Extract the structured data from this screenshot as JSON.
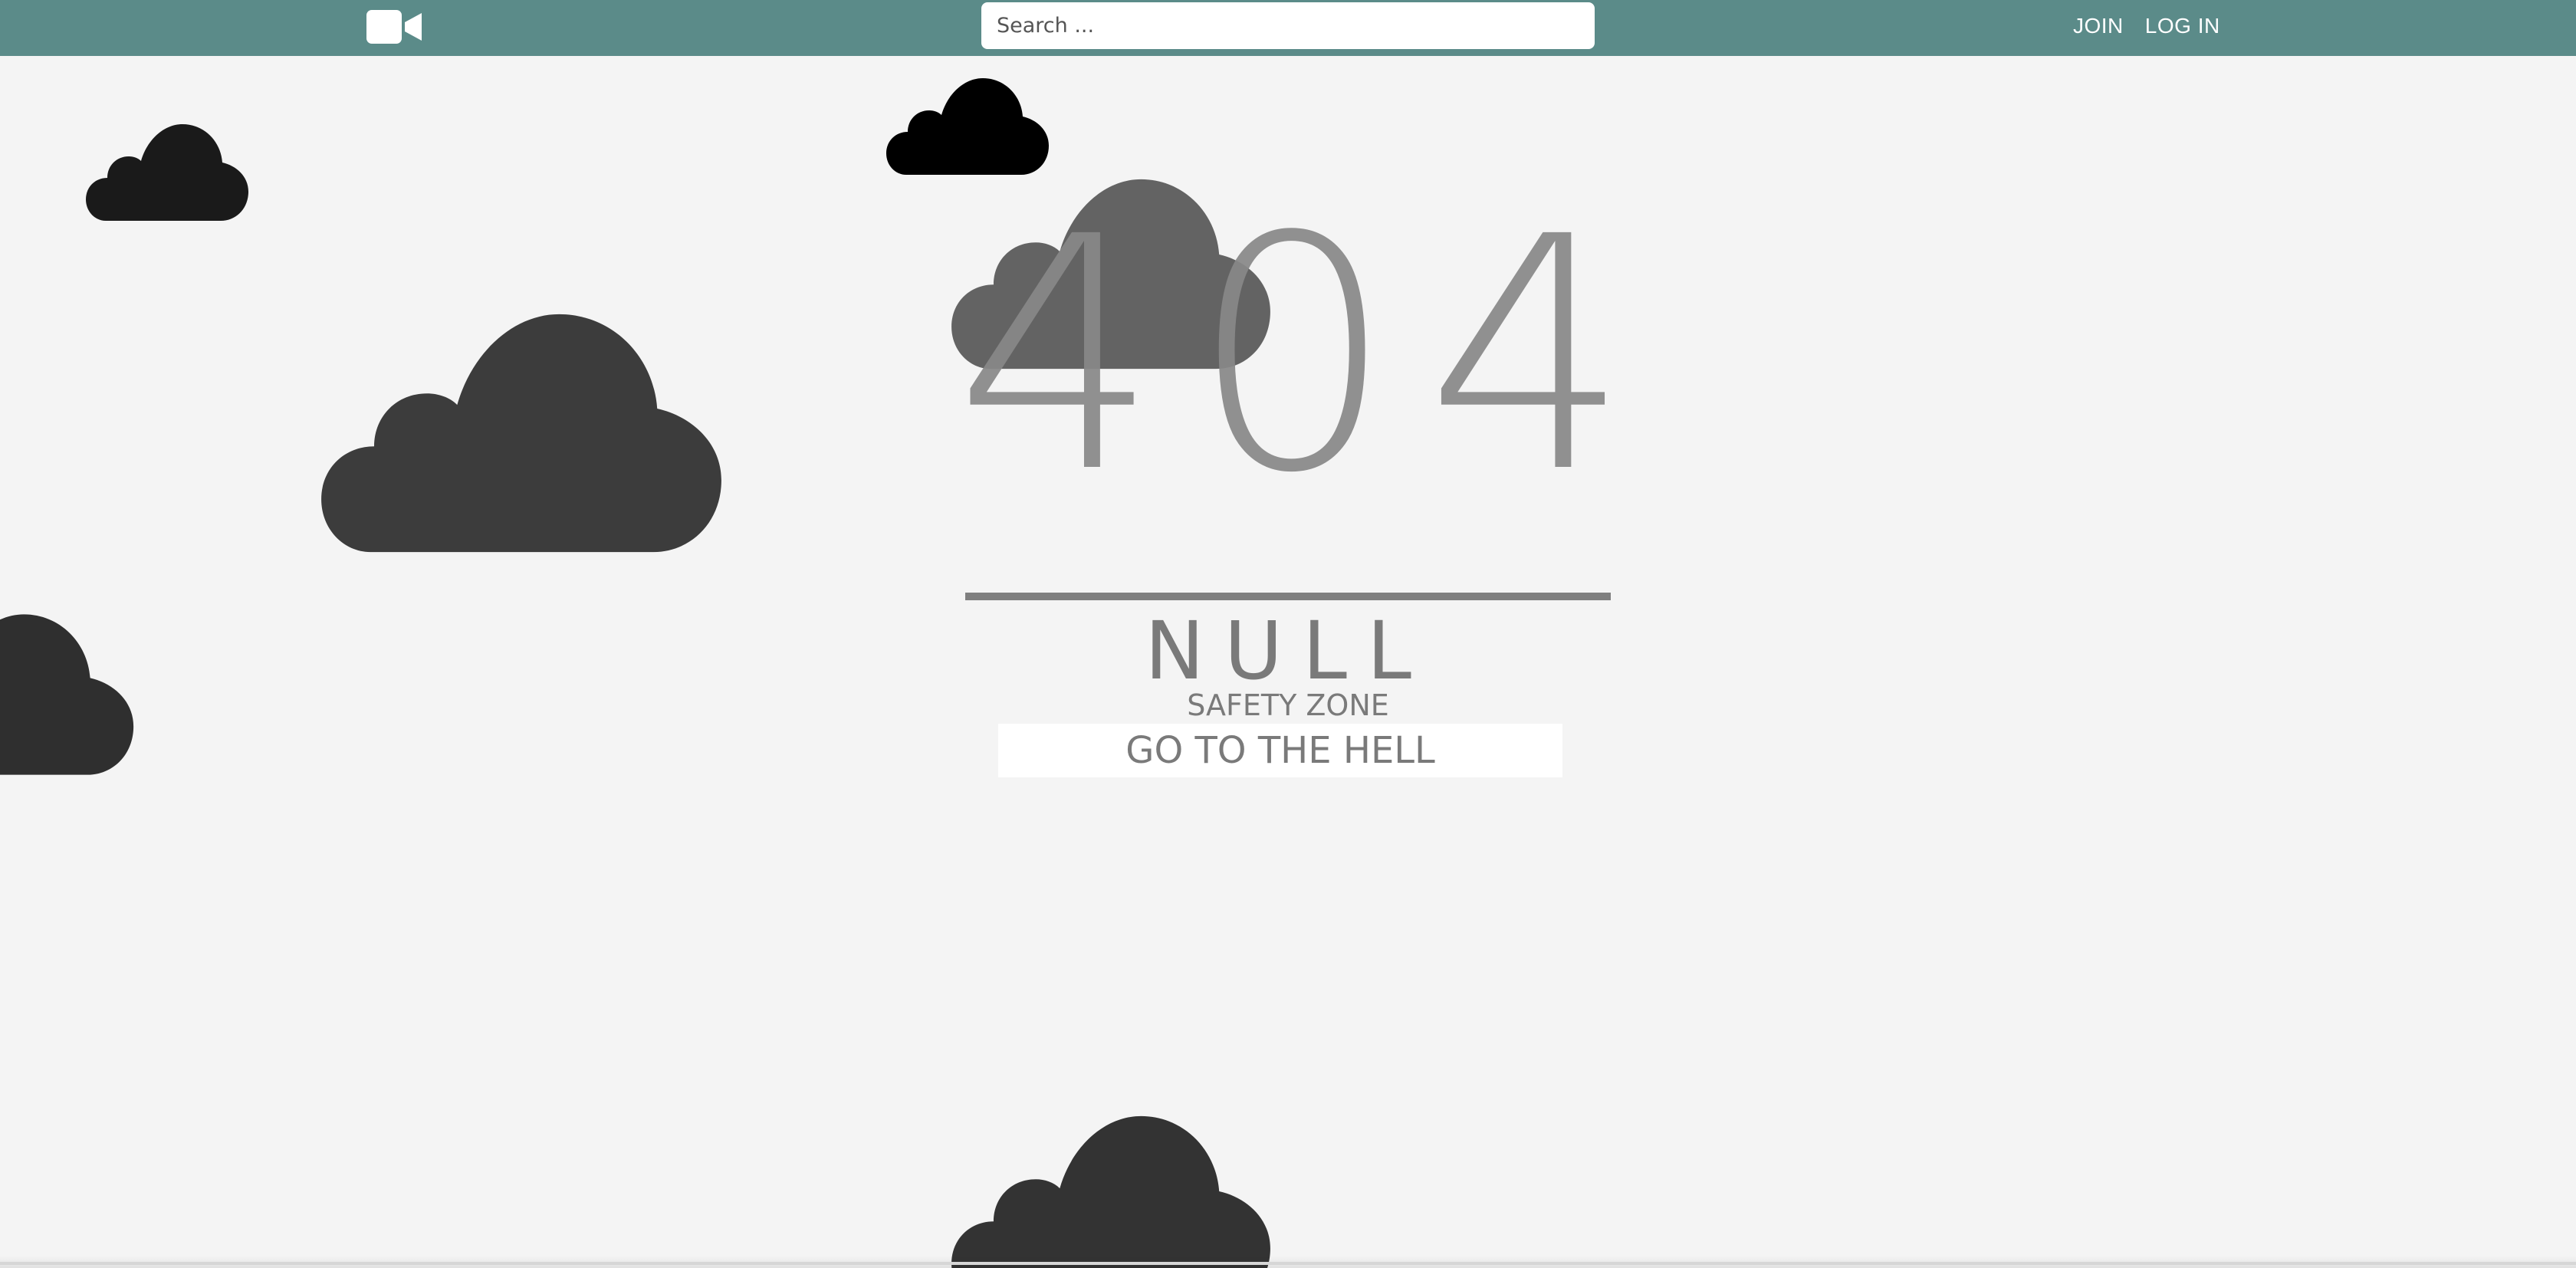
{
  "navbar": {
    "logo_icon": "video-camera-icon",
    "search_placeholder": "Search ...",
    "search_value": "",
    "join_label": "JOIN",
    "login_label": "LOG IN",
    "background_color": "#5b8b89"
  },
  "error": {
    "code": "404",
    "title": "NULL",
    "subtitle": "SAFETY ZONE",
    "button_label": "GO TO THE HELL",
    "text_color": "#888888"
  },
  "decor": {
    "cloud_icon": "cloud-icon",
    "cloud_colors": [
      "#1a1a1a",
      "#000000",
      "#636363",
      "#3c3c3c",
      "#2f2f2f",
      "#333333"
    ]
  }
}
